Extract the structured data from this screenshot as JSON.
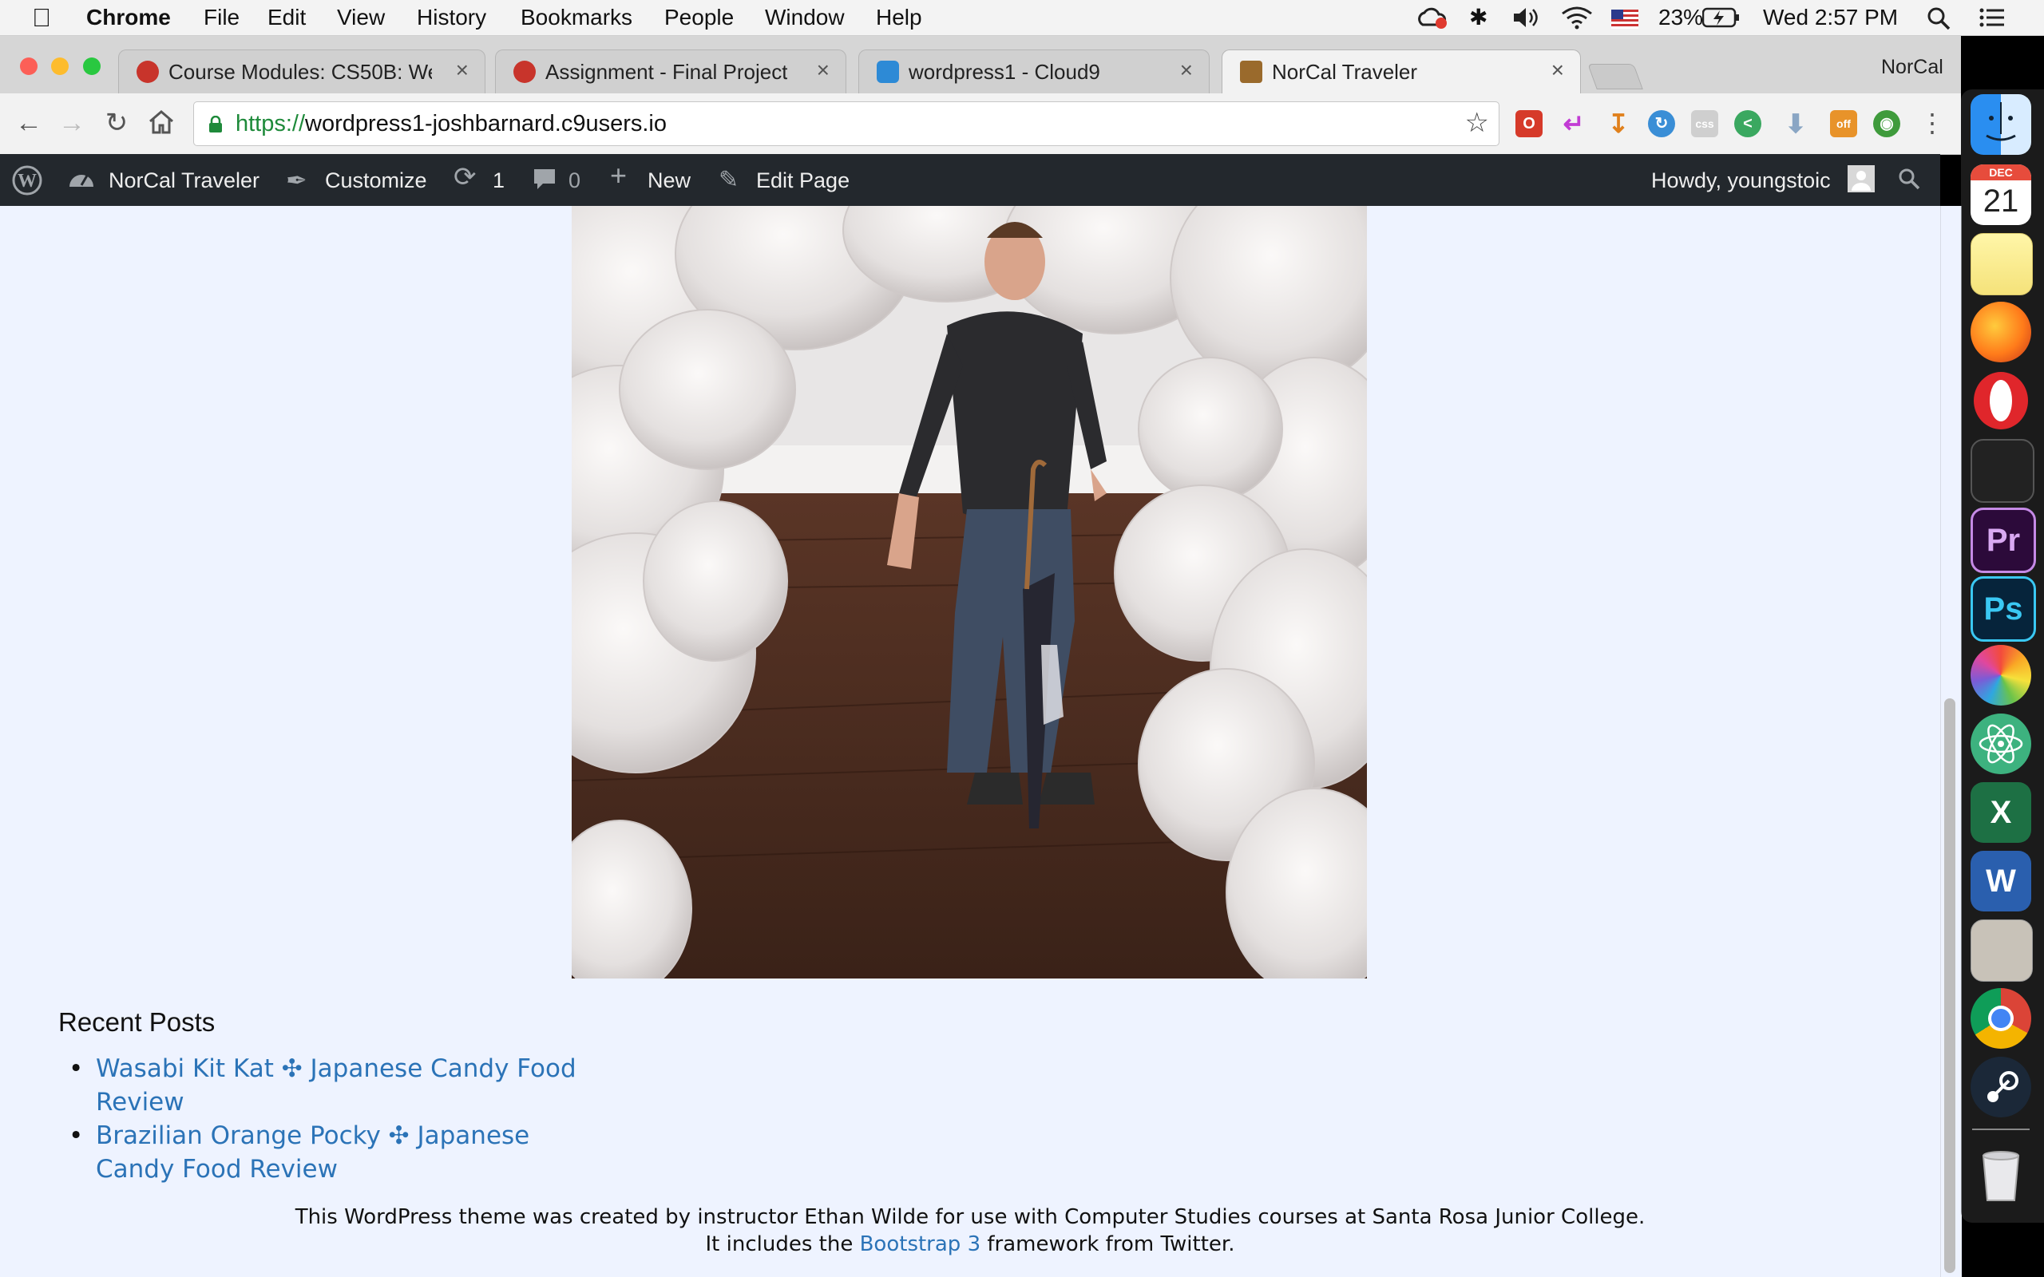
{
  "menubar": {
    "app": "Chrome",
    "items": [
      "File",
      "Edit",
      "View",
      "History",
      "Bookmarks",
      "People",
      "Window",
      "Help"
    ],
    "battery": "23%",
    "clock": "Wed 2:57 PM"
  },
  "tabs": [
    {
      "label": "Course Modules: CS50B: Web",
      "close": "×"
    },
    {
      "label": "Assignment - Final Project",
      "close": "×"
    },
    {
      "label": "wordpress1 - Cloud9",
      "close": "×"
    },
    {
      "label": "NorCal Traveler",
      "close": "×"
    }
  ],
  "profile_label": "NorCal",
  "omnibox": {
    "scheme": "https://",
    "host": "wordpress1-joshbarnard.c9users.io"
  },
  "adminbar": {
    "site_name": "NorCal Traveler",
    "customize": "Customize",
    "updates_count": "1",
    "comments_count": "0",
    "new_label": "New",
    "edit_label": "Edit Page",
    "howdy": "Howdy, youngstoic"
  },
  "recent_posts": {
    "title": "Recent Posts",
    "items": [
      {
        "line1": "Wasabi Kit Kat ✣ Japanese Candy Food",
        "line2": "Review"
      },
      {
        "line1": "Brazilian Orange Pocky ✣ Japanese",
        "line2": "Candy Food Review"
      }
    ]
  },
  "footer": {
    "line1": "This WordPress theme was created by instructor Ethan Wilde for use with Computer Studies courses at Santa Rosa Junior College.",
    "line2_pre": "It includes the",
    "line2_link": "Bootstrap 3",
    "line2_post": "framework from Twitter."
  },
  "dock": {
    "calendar_month": "DEC",
    "calendar_day": "21",
    "premiere": "Pr",
    "photoshop": "Ps",
    "excel": "X",
    "word": "W"
  }
}
